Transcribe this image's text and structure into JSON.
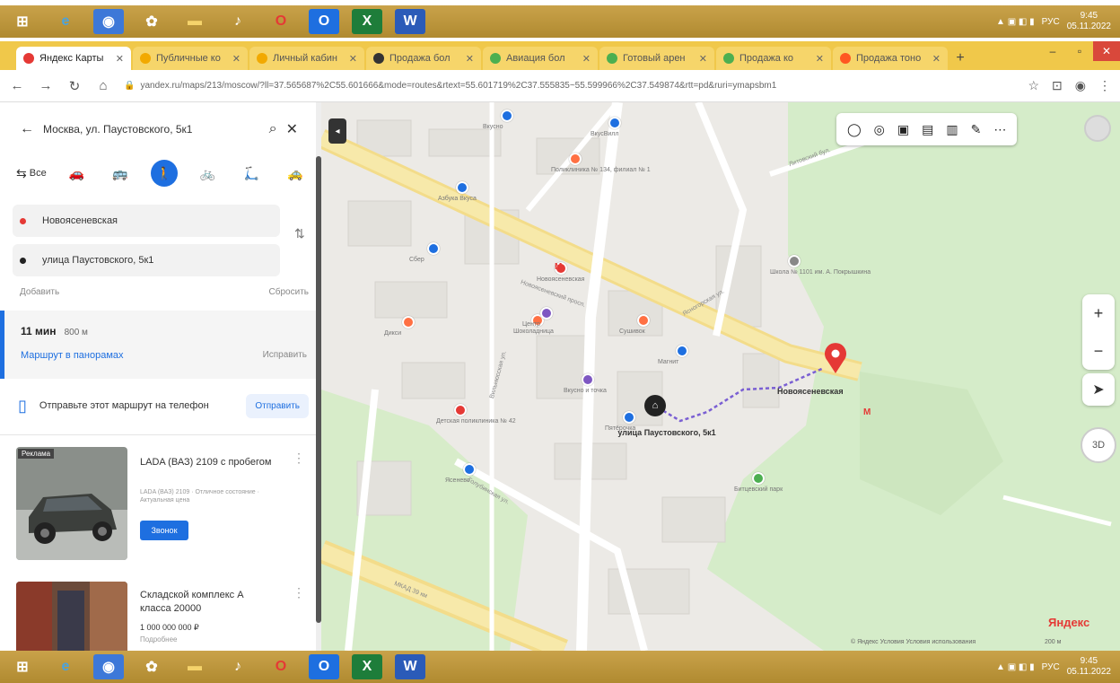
{
  "browser": {
    "tabs": [
      {
        "label": "Яндекс Карты",
        "color": "#e53935",
        "active": true
      },
      {
        "label": "Публичные ко",
        "color": "#f2a900",
        "active": false
      },
      {
        "label": "Личный кабин",
        "color": "#f2a900",
        "active": false
      },
      {
        "label": "Продажа бол",
        "color": "#333333",
        "active": false
      },
      {
        "label": "Авиация бол",
        "color": "#4caf50",
        "active": false
      },
      {
        "label": "Готовый арен",
        "color": "#4caf50",
        "active": false
      },
      {
        "label": "Продажа ко",
        "color": "#4caf50",
        "active": false
      },
      {
        "label": "Продажа тоно",
        "color": "#ff5722",
        "active": false
      }
    ],
    "url": "yandex.ru/maps/213/moscow/?ll=37.565687%2C55.601666&mode=routes&rtext=55.601719%2C37.555835~55.599966%2C37.549874&rtt=pd&ruri=ymapsbm1"
  },
  "search": {
    "value": "Москва, ул. Паустовского, 5к1"
  },
  "modes": [
    {
      "icon": "all-icon",
      "glyph": "⇆",
      "label": "Все"
    },
    {
      "icon": "car-icon",
      "glyph": "🚗",
      "label": ""
    },
    {
      "icon": "bus-icon",
      "glyph": "🚌",
      "label": ""
    },
    {
      "icon": "pedestrian-icon",
      "glyph": "🚶",
      "label": ""
    },
    {
      "icon": "bicycle-icon",
      "glyph": "🚲",
      "label": ""
    },
    {
      "icon": "scooter-icon",
      "glyph": "🛴",
      "label": ""
    },
    {
      "icon": "taxi-icon",
      "glyph": "🚕",
      "label": ""
    }
  ],
  "route": {
    "from": "Новоясеневская",
    "to": "улица Паустовского, 5к1",
    "add": "Добавить",
    "reset": "Сбросить",
    "time": "11 мин",
    "distance": "800 м",
    "panorama": "Маршрут в панорамах",
    "edit": "Исправить",
    "send_text": "Отправьте этот маршрут на телефон",
    "send_button": "Отправить"
  },
  "ads": [
    {
      "badge": "Реклама",
      "title": "LADA (ВАЗ) 2109 с пробегом",
      "desc": "LADA (ВАЗ) 2109 · Отличное состояние · Актуальная цена",
      "button": "Звонок"
    },
    {
      "badge": "",
      "title": "Складской комплекс А класса 20000",
      "price": "1 000 000 000 ₽",
      "sub": "Подробнее"
    }
  ],
  "map": {
    "pin_label": "Новоясеневская",
    "dest_label": "улица Паустовского, 5к1",
    "logo": "Яндекс",
    "copyright": "© Яндекс  Условия  Условия использования",
    "scale": "200 м",
    "control_3d": "3D",
    "streets": [
      "Новоясеневский просп.",
      "Ясногорская ул.",
      "Вильнюсская ул.",
      "Голубинская ул.",
      "МКАД 39 км",
      "Литовский бул."
    ],
    "pois": [
      {
        "name": "Вкусно",
        "color": "#1e6fe0"
      },
      {
        "name": "ВкусВилл",
        "color": "#1e6fe0"
      },
      {
        "name": "Поликлиника № 134, филиал № 1",
        "color": "#ff7043"
      },
      {
        "name": "Азбука Вкуса",
        "color": "#1e6fe0"
      },
      {
        "name": "Сбер",
        "color": "#1e6fe0"
      },
      {
        "name": "Новоясеневская",
        "color": "#e53935"
      },
      {
        "name": "Школа № 1101 им. А. Покрышкина",
        "color": "#888888"
      },
      {
        "name": "Сушивок",
        "color": "#ff7043"
      },
      {
        "name": "Дикси",
        "color": "#ff7043"
      },
      {
        "name": "Шоколадница",
        "color": "#ff7043"
      },
      {
        "name": "Магнит",
        "color": "#1e6fe0"
      },
      {
        "name": "Пятёрочка",
        "color": "#1e6fe0"
      },
      {
        "name": "Детская поликлиника № 42",
        "color": "#e53935"
      },
      {
        "name": "Битцевский парк",
        "color": "#4caf50"
      },
      {
        "name": "Ясенево",
        "color": "#1e6fe0"
      },
      {
        "name": "Центр",
        "color": "#7e57c2"
      },
      {
        "name": "Вкусно и точка",
        "color": "#7e57c2"
      }
    ]
  },
  "tray": {
    "lang": "РУС",
    "time": "9:45",
    "date": "05.11.2022"
  }
}
